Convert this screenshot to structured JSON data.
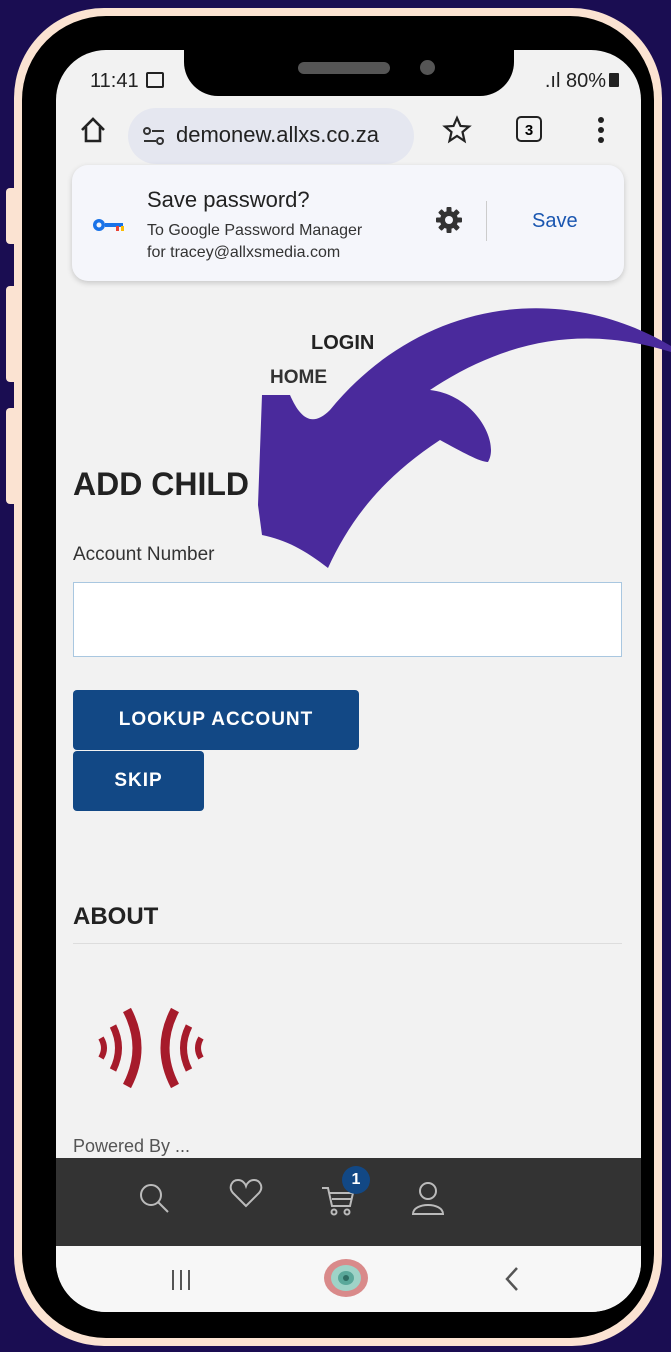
{
  "status_bar": {
    "time": "11:41",
    "battery": "80%"
  },
  "browser": {
    "url": "demonew.allxs.co.za",
    "tab_count": "3"
  },
  "password_prompt": {
    "title": "Save password?",
    "line1": "To Google Password Manager",
    "line2": "for tracey@allxsmedia.com",
    "save_label": "Save"
  },
  "nav": {
    "login": "LOGIN",
    "home": "HOME"
  },
  "form": {
    "heading": "ADD CHILD",
    "account_label": "Account Number",
    "account_value": "",
    "lookup_button": "LOOKUP ACCOUNT",
    "skip_button": "SKIP"
  },
  "about": {
    "heading": "ABOUT",
    "powered_by": "Powered By ..."
  },
  "bottom_nav": {
    "cart_count": "1"
  },
  "colors": {
    "background": "#1a0d52",
    "phone_frame": "#fbe3d2",
    "button": "#124885",
    "arrow": "#4a2a9c",
    "logo_red": "#a61b2b"
  }
}
